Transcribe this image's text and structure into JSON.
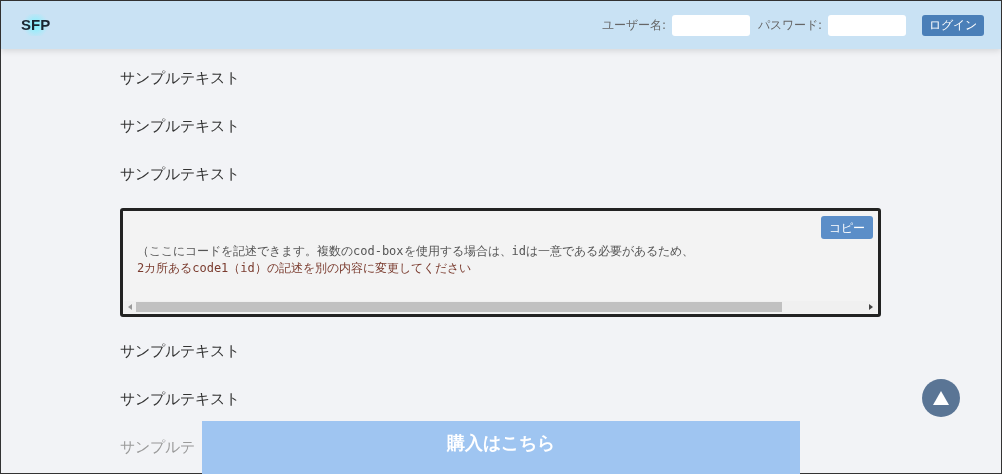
{
  "header": {
    "logo": "SFP",
    "username_label": "ユーザー名:",
    "password_label": "パスワード:",
    "login_button": "ログイン"
  },
  "texts_before": [
    "サンプルテキスト",
    "サンプルテキスト",
    "サンプルテキスト"
  ],
  "code_box": {
    "copy_button": "コピー",
    "code": [
      {
        "text": "（ここにコードを記述できます。複数のcod-boxを使用する場合は、idは一意である必要があるため、",
        "color": "#555555"
      },
      {
        "text": "2カ所あるcode1（id）の記述を別の内容に変更してください",
        "color": "#7a3b2e"
      }
    ]
  },
  "texts_after": [
    "サンプルテキスト",
    "サンプルテキスト",
    "サンプルテ"
  ],
  "purchase_button": "購入はこちら"
}
